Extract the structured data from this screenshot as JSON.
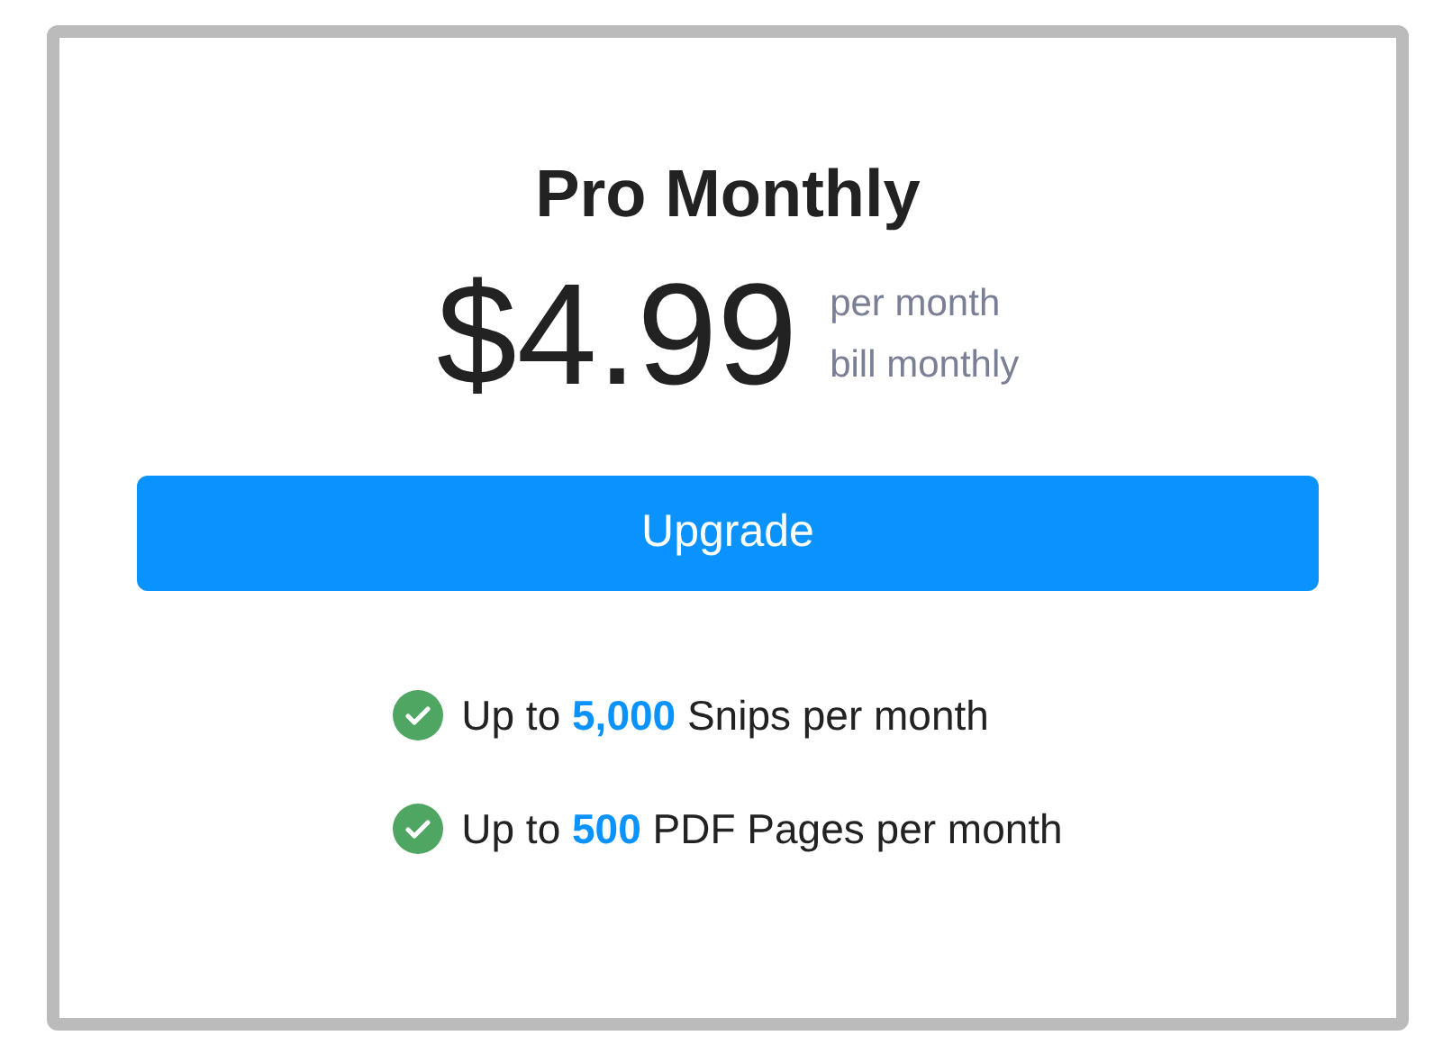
{
  "plan": {
    "title": "Pro Monthly",
    "price": "$4.99",
    "period": "per month",
    "billing": "bill monthly"
  },
  "button": {
    "label": "Upgrade"
  },
  "features": [
    {
      "text": "Up to **5,000** Snips per month",
      "checked": true
    },
    {
      "text": "Up to **500** PDF Pages per month",
      "checked": true
    }
  ]
}
